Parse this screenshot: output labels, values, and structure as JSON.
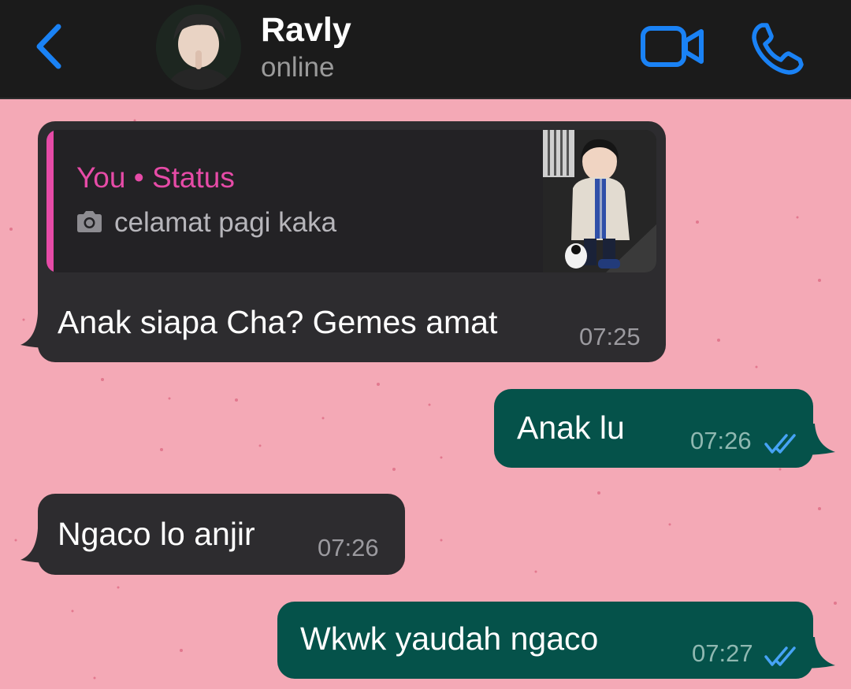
{
  "header": {
    "contact_name": "Ravly",
    "status": "online",
    "icons": {
      "back": "chevron-left-icon",
      "video": "video-camera-icon",
      "call": "phone-icon"
    },
    "accent_color": "#1a82f5"
  },
  "chat": {
    "background_color": "#f4a9b6",
    "messages": [
      {
        "direction": "incoming",
        "reply": {
          "author": "You • Status",
          "caption": "celamat pagi kaka",
          "media_icon": "camera-icon",
          "thumbnail": "status-photo"
        },
        "text": "Anak siapa Cha? Gemes amat",
        "time": "07:25"
      },
      {
        "direction": "outgoing",
        "text": "Anak lu",
        "time": "07:26",
        "status_icon": "double-check-icon"
      },
      {
        "direction": "incoming",
        "text": "Ngaco lo anjir",
        "time": "07:26"
      },
      {
        "direction": "outgoing",
        "text": "Wkwk yaudah ngaco",
        "time": "07:27",
        "status_icon": "double-check-icon"
      }
    ]
  },
  "colors": {
    "incoming_bubble": "#2d2c2f",
    "outgoing_bubble": "#05524a",
    "reply_accent": "#e64ba7"
  }
}
